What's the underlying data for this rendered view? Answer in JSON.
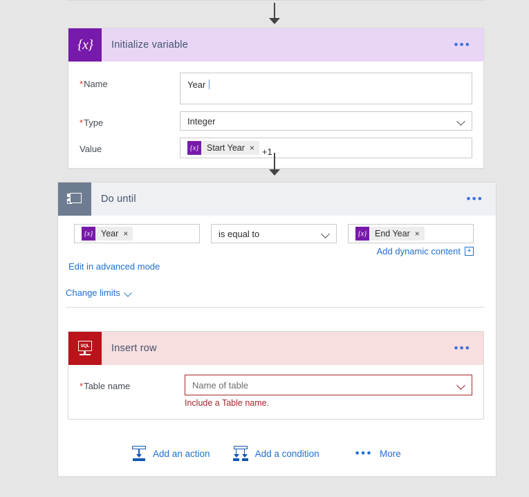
{
  "canvas": {
    "background_color": "#e6e6e6",
    "connector_color": "#444444"
  },
  "initialize_variable_card": {
    "title": "Initialize variable",
    "icon": "braces-x-icon",
    "icon_color": "#7719aa",
    "header_color": "#e9d6f7",
    "overflow_menu": "•••",
    "fields": [
      {
        "label": "Name",
        "required_marker": "*",
        "value": "Year"
      },
      {
        "label": "Type",
        "required_marker": "*",
        "value": "Integer"
      },
      {
        "label": "Value",
        "required_marker": "",
        "token": "Start Year",
        "token_remove": "×",
        "suffix": "+1"
      }
    ]
  },
  "do_until_card": {
    "title": "Do until",
    "icon": "loop-icon",
    "icon_color": "#6e7c91",
    "header_color": "#eef0f4",
    "overflow_menu": "•••",
    "condition": {
      "left_token": "Year",
      "left_token_remove": "×",
      "operator": "is equal to",
      "right_token": "End Year",
      "right_token_remove": "×"
    },
    "add_dynamic_content": "Add dynamic content",
    "add_dynamic_plus": "+",
    "edit_advanced_mode": "Edit in advanced mode",
    "change_limits": "Change limits"
  },
  "insert_row_card": {
    "title": "Insert row",
    "icon": "sql-server-icon",
    "icon_label": "SQL",
    "icon_color": "#ba141a",
    "header_color": "#f7dedf",
    "overflow_menu": "•••",
    "field": {
      "label": "Table name",
      "required_marker": "*",
      "placeholder": "Name of table",
      "error_message": "Include a Table name.",
      "error_color": "#a4262c"
    }
  },
  "bottom_actions": {
    "add_action": "Add an action",
    "add_condition": "Add a condition",
    "more": "More",
    "more_dots": "•••"
  }
}
